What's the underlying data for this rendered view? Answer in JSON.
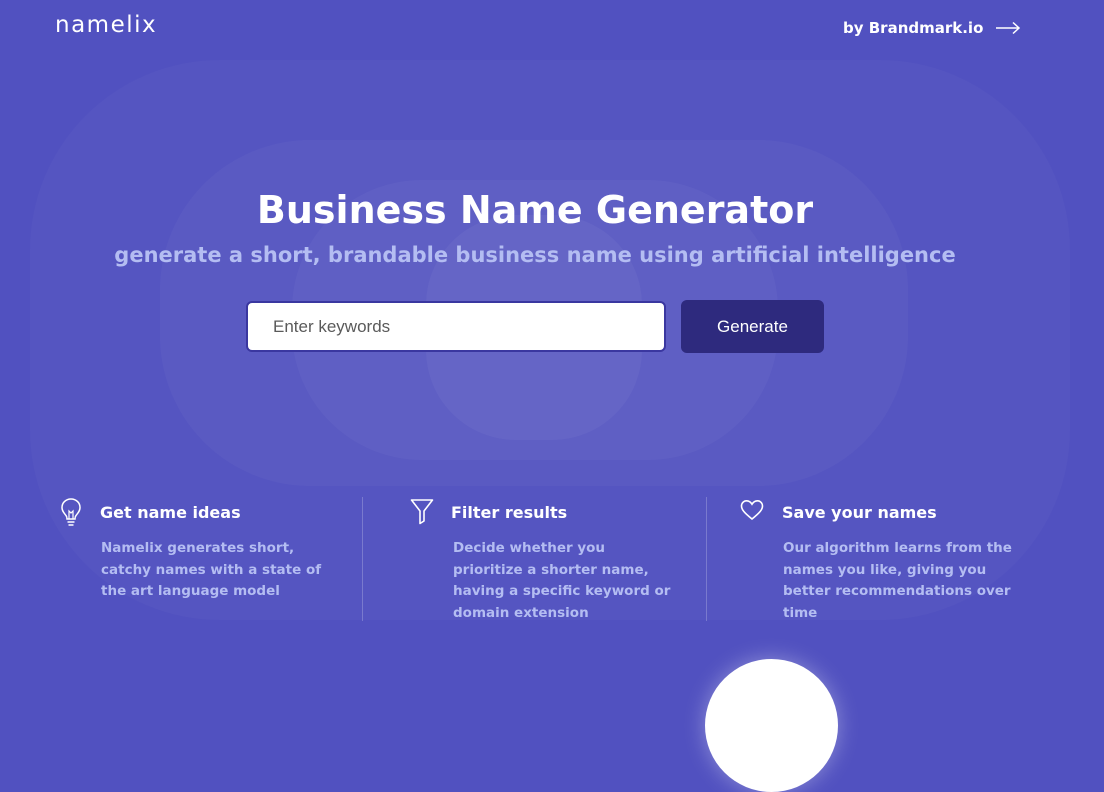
{
  "header": {
    "logo": "namelix",
    "byline": "by Brandmark.io",
    "byline_icon": "arrow-right-icon"
  },
  "hero": {
    "title": "Business Name Generator",
    "subtitle": "generate a short, brandable business name using artificial intelligence"
  },
  "search": {
    "placeholder": "Enter keywords",
    "value": "",
    "button_label": "Generate"
  },
  "features": [
    {
      "icon": "lightbulb-icon",
      "title": "Get name ideas",
      "description": "Namelix generates short, catchy names with a state of the art language model"
    },
    {
      "icon": "filter-icon",
      "title": "Filter results",
      "description": "Decide whether you prioritize a shorter name, having a specific keyword or domain extension"
    },
    {
      "icon": "heart-icon",
      "title": "Save your names",
      "description": "Our algorithm learns from the names you like, giving you better recommendations over time"
    }
  ],
  "colors": {
    "background": "#5151c0",
    "button": "#2e2a7e",
    "subtitle": "#b4bdf2"
  }
}
